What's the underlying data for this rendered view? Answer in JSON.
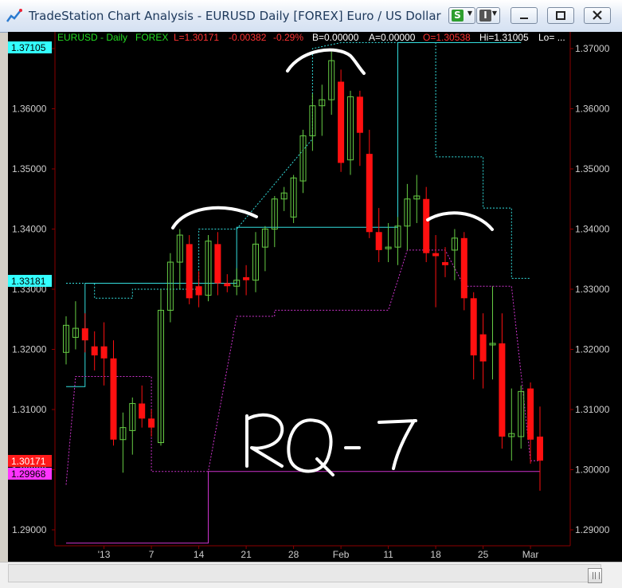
{
  "window": {
    "title": "TradeStation Chart Analysis - EURUSD Daily [FOREX] Euro / US Dollar",
    "buttons": {
      "s_label": "S",
      "i_label": "I"
    }
  },
  "legend": {
    "symbol": "EURUSD - Daily",
    "exchange": "FOREX",
    "last": "L=1.30171",
    "change": "-0.00382",
    "change_pct": "-0.29%",
    "bid": "B=0.00000",
    "ask": "A=0.00000",
    "open": "O=1.30538",
    "high": "Hi=1.31005",
    "low": "Lo= ..."
  },
  "price_markers": {
    "upper_channel": "1.37105",
    "mid_level": "1.33181",
    "last_price": "1.30171",
    "lower_channel": "1.29968"
  },
  "annotation": {
    "text": "RQ- 7"
  },
  "colors": {
    "up_candle": "#66cc44",
    "down_candle": "#ff1010",
    "upper_band": "#33dddd",
    "lower_band": "#cc33cc",
    "grid": "#8b0000",
    "axis_text": "#cccccc"
  },
  "chart_data": {
    "type": "candlestick",
    "title": "EURUSD - Daily",
    "ylim": [
      1.2875,
      1.3735
    ],
    "y_ticks": [
      "1.29000",
      "1.30000",
      "1.31000",
      "1.32000",
      "1.33000",
      "1.34000",
      "1.35000",
      "1.36000",
      "1.37000"
    ],
    "x_ticks": [
      "'13",
      "7",
      "14",
      "21",
      "28",
      "Feb",
      "11",
      "18",
      "25",
      "Mar"
    ],
    "candles": [
      {
        "o": 1.3195,
        "h": 1.3255,
        "l": 1.3175,
        "c": 1.324
      },
      {
        "o": 1.322,
        "h": 1.328,
        "l": 1.32,
        "c": 1.3235
      },
      {
        "o": 1.3235,
        "h": 1.326,
        "l": 1.3195,
        "c": 1.3215
      },
      {
        "o": 1.3205,
        "h": 1.323,
        "l": 1.3165,
        "c": 1.319
      },
      {
        "o": 1.3205,
        "h": 1.3245,
        "l": 1.314,
        "c": 1.3185
      },
      {
        "o": 1.3185,
        "h": 1.3215,
        "l": 1.304,
        "c": 1.305
      },
      {
        "o": 1.305,
        "h": 1.3095,
        "l": 1.2995,
        "c": 1.307
      },
      {
        "o": 1.3065,
        "h": 1.312,
        "l": 1.3025,
        "c": 1.311
      },
      {
        "o": 1.311,
        "h": 1.314,
        "l": 1.307,
        "c": 1.3085
      },
      {
        "o": 1.3085,
        "h": 1.31,
        "l": 1.3055,
        "c": 1.307
      },
      {
        "o": 1.3045,
        "h": 1.33,
        "l": 1.304,
        "c": 1.3265
      },
      {
        "o": 1.3265,
        "h": 1.336,
        "l": 1.3245,
        "c": 1.3345
      },
      {
        "o": 1.3345,
        "h": 1.34,
        "l": 1.33,
        "c": 1.339
      },
      {
        "o": 1.3375,
        "h": 1.339,
        "l": 1.3275,
        "c": 1.3285
      },
      {
        "o": 1.3305,
        "h": 1.333,
        "l": 1.327,
        "c": 1.329
      },
      {
        "o": 1.329,
        "h": 1.339,
        "l": 1.328,
        "c": 1.338
      },
      {
        "o": 1.3375,
        "h": 1.3395,
        "l": 1.329,
        "c": 1.331
      },
      {
        "o": 1.331,
        "h": 1.3325,
        "l": 1.3295,
        "c": 1.3305
      },
      {
        "o": 1.3305,
        "h": 1.3335,
        "l": 1.329,
        "c": 1.3315
      },
      {
        "o": 1.332,
        "h": 1.334,
        "l": 1.329,
        "c": 1.3315
      },
      {
        "o": 1.3315,
        "h": 1.3395,
        "l": 1.3295,
        "c": 1.3375
      },
      {
        "o": 1.337,
        "h": 1.3405,
        "l": 1.333,
        "c": 1.34
      },
      {
        "o": 1.34,
        "h": 1.3455,
        "l": 1.337,
        "c": 1.345
      },
      {
        "o": 1.345,
        "h": 1.347,
        "l": 1.343,
        "c": 1.346
      },
      {
        "o": 1.342,
        "h": 1.349,
        "l": 1.341,
        "c": 1.3485
      },
      {
        "o": 1.348,
        "h": 1.3565,
        "l": 1.346,
        "c": 1.3555
      },
      {
        "o": 1.3555,
        "h": 1.3625,
        "l": 1.353,
        "c": 1.3605
      },
      {
        "o": 1.3605,
        "h": 1.364,
        "l": 1.3555,
        "c": 1.3615
      },
      {
        "o": 1.3615,
        "h": 1.3695,
        "l": 1.359,
        "c": 1.368
      },
      {
        "o": 1.3645,
        "h": 1.3665,
        "l": 1.3495,
        "c": 1.351
      },
      {
        "o": 1.3515,
        "h": 1.363,
        "l": 1.349,
        "c": 1.362
      },
      {
        "o": 1.362,
        "h": 1.363,
        "l": 1.3505,
        "c": 1.356
      },
      {
        "o": 1.3525,
        "h": 1.3565,
        "l": 1.3385,
        "c": 1.3395
      },
      {
        "o": 1.3395,
        "h": 1.3435,
        "l": 1.3345,
        "c": 1.3365
      },
      {
        "o": 1.337,
        "h": 1.341,
        "l": 1.3345,
        "c": 1.337
      },
      {
        "o": 1.337,
        "h": 1.342,
        "l": 1.334,
        "c": 1.3405
      },
      {
        "o": 1.3405,
        "h": 1.3475,
        "l": 1.3365,
        "c": 1.345
      },
      {
        "o": 1.345,
        "h": 1.349,
        "l": 1.341,
        "c": 1.3455
      },
      {
        "o": 1.345,
        "h": 1.347,
        "l": 1.3345,
        "c": 1.336
      },
      {
        "o": 1.336,
        "h": 1.339,
        "l": 1.327,
        "c": 1.3355
      },
      {
        "o": 1.3345,
        "h": 1.337,
        "l": 1.332,
        "c": 1.334
      },
      {
        "o": 1.3365,
        "h": 1.34,
        "l": 1.3315,
        "c": 1.3385
      },
      {
        "o": 1.3385,
        "h": 1.3395,
        "l": 1.3265,
        "c": 1.3285
      },
      {
        "o": 1.3285,
        "h": 1.3295,
        "l": 1.315,
        "c": 1.319
      },
      {
        "o": 1.3225,
        "h": 1.326,
        "l": 1.3135,
        "c": 1.318
      },
      {
        "o": 1.321,
        "h": 1.3305,
        "l": 1.315,
        "c": 1.321
      },
      {
        "o": 1.321,
        "h": 1.326,
        "l": 1.3035,
        "c": 1.3055
      },
      {
        "o": 1.3055,
        "h": 1.3135,
        "l": 1.3015,
        "c": 1.306
      },
      {
        "o": 1.3055,
        "h": 1.314,
        "l": 1.3035,
        "c": 1.313
      },
      {
        "o": 1.3135,
        "h": 1.3145,
        "l": 1.301,
        "c": 1.305
      },
      {
        "o": 1.3055,
        "h": 1.3105,
        "l": 1.2965,
        "c": 1.3015
      }
    ],
    "upper_channel": [
      {
        "from": 0,
        "to": 2,
        "v": 1.3138,
        "dashed": false
      },
      {
        "from": 2,
        "to": 13,
        "v": 1.331,
        "dashed": false
      },
      {
        "from": 14,
        "to": 18,
        "v": 1.331,
        "dashed": false
      },
      {
        "from": 18,
        "to": 35,
        "v": 1.3403,
        "dashed": false
      },
      {
        "from": 35,
        "to": 39,
        "v": 1.371,
        "dashed": false
      },
      {
        "from": 39,
        "to": 48,
        "v": 1.371,
        "dashed": false
      }
    ],
    "upper_dashed": [
      [
        0,
        1.331
      ],
      [
        3,
        1.331
      ],
      [
        3,
        1.3285
      ],
      [
        7,
        1.3285
      ],
      [
        7,
        1.33
      ],
      [
        14,
        1.33
      ],
      [
        14,
        1.34
      ],
      [
        18,
        1.34
      ],
      [
        26,
        1.355
      ],
      [
        26,
        1.37
      ],
      [
        29,
        1.371
      ],
      [
        39,
        1.371
      ],
      [
        39,
        1.352
      ],
      [
        44,
        1.352
      ],
      [
        44,
        1.3435
      ],
      [
        47,
        1.3435
      ],
      [
        47,
        1.3318
      ],
      [
        49,
        1.3318
      ]
    ],
    "lower_channel": [
      [
        0,
        1.2878
      ],
      [
        15,
        1.2878
      ],
      [
        15,
        1.2997
      ],
      [
        50,
        1.2997
      ]
    ],
    "lower_dashed": [
      [
        0,
        1.2975
      ],
      [
        1,
        1.3155
      ],
      [
        9,
        1.3155
      ],
      [
        9,
        1.2997
      ],
      [
        15,
        1.2997
      ],
      [
        18,
        1.3255
      ],
      [
        22,
        1.3255
      ],
      [
        22,
        1.3265
      ],
      [
        34,
        1.3265
      ],
      [
        36,
        1.3365
      ],
      [
        40,
        1.3365
      ],
      [
        42,
        1.3305
      ],
      [
        47,
        1.3305
      ],
      [
        49,
        1.3015
      ],
      [
        50,
        1.3015
      ]
    ]
  }
}
